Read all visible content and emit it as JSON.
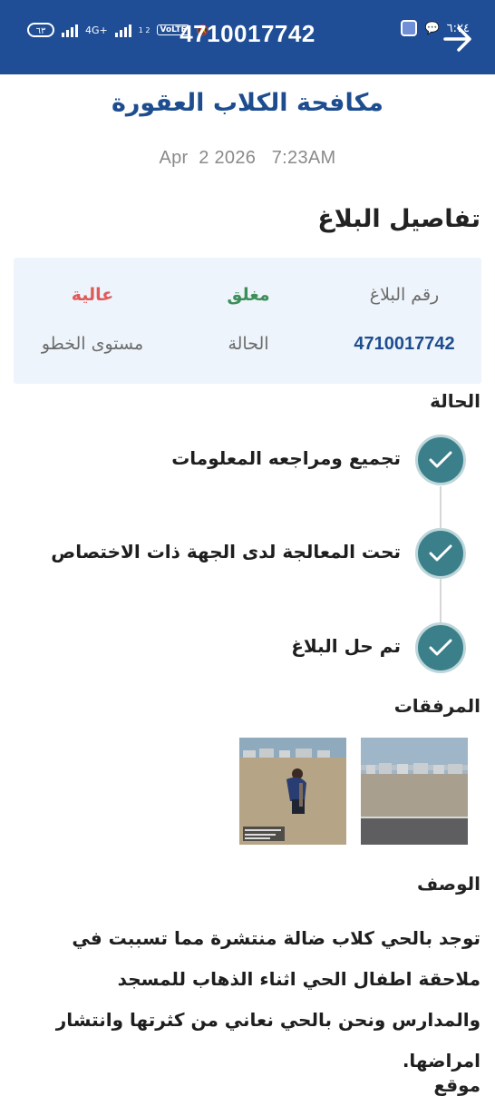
{
  "status_bar": {
    "battery": "٦٣",
    "signal_1": "4G+",
    "signal_2": "1 2",
    "volte": "VoLTE",
    "time": "٦:٢٤"
  },
  "header": {
    "title": "4710017742",
    "back_icon": "arrow-right-icon"
  },
  "report": {
    "title": "مكافحة الكلاب العقورة",
    "datetime": "Apr  2 2026   7:23AM"
  },
  "details": {
    "heading": "تفاصيل البلاغ",
    "number_label": "رقم البلاغ",
    "number_value": "4710017742",
    "status_value": "مغلق",
    "status_label": "الحالة",
    "severity_value": "عالية",
    "severity_label": "مستوى الخطو",
    "colors": {
      "closed": "#3b8f58",
      "high": "#e05a5a",
      "accent": "#1e4d8f"
    }
  },
  "timeline": {
    "heading": "الحالة",
    "steps": [
      {
        "label": "تجميع ومراجعه المعلومات",
        "icon": "check-icon"
      },
      {
        "label": "تحت المعالجة لدى الجهة ذات الاختصاص",
        "icon": "check-icon"
      },
      {
        "label": "تم حل البلاغ",
        "icon": "check-icon"
      }
    ]
  },
  "attachments": {
    "heading": "المرفقات"
  },
  "description": {
    "heading": "الوصف",
    "text": "توجد بالحي كلاب ضالة منتشرة مما تسببت في ملاحقة اطفال الحي اثناء الذهاب للمسجد والمدارس ونحن بالحي نعاني من كثرتها وانتشار امراضها."
  },
  "next_section_partial": "موقع"
}
